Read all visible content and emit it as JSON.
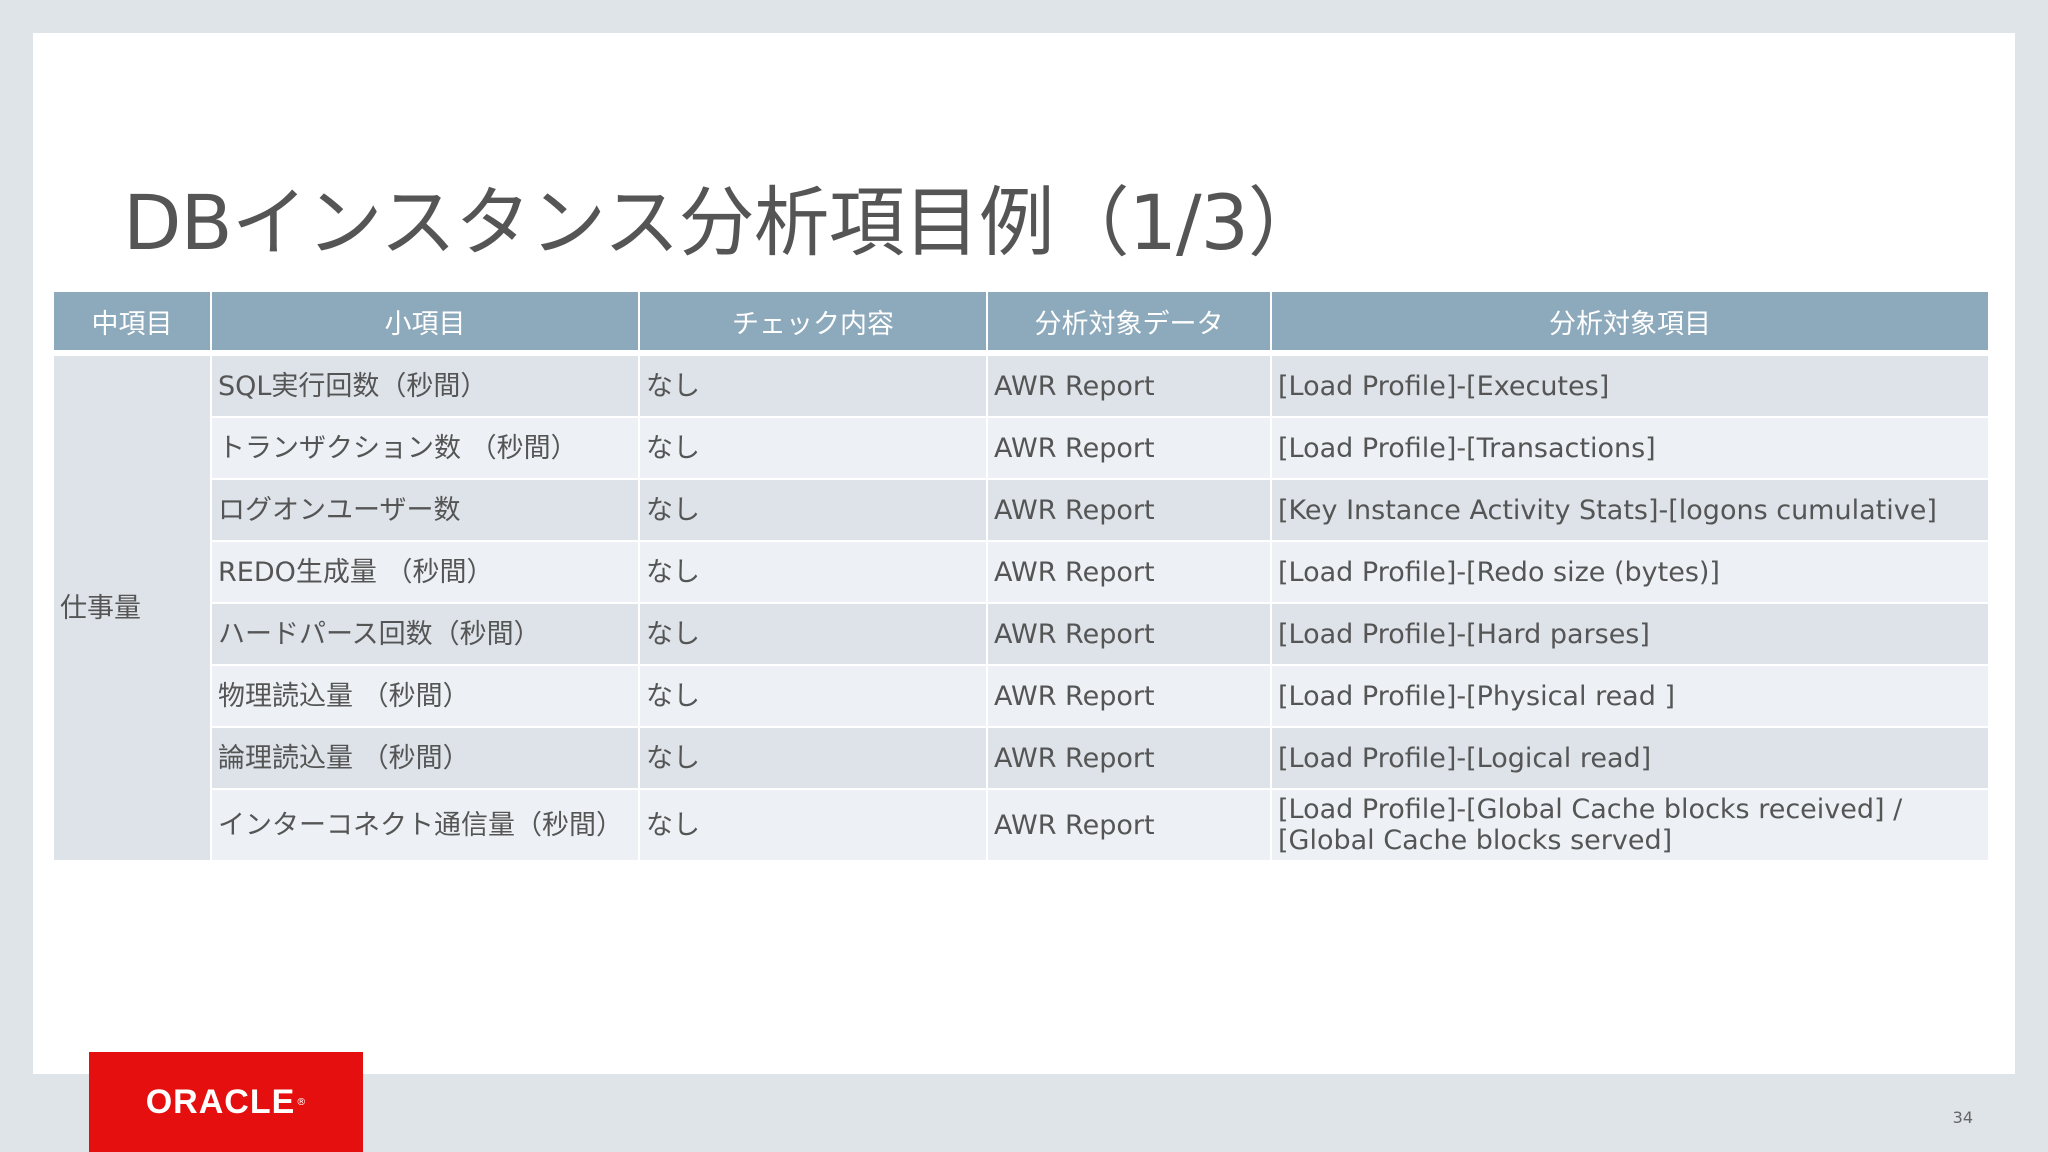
{
  "slide": {
    "title": "DBインスタンス分析項目例（1/3）",
    "page_number": "34"
  },
  "table": {
    "headers": [
      "中項目",
      "小項目",
      "チェック内容",
      "分析対象データ",
      "分析対象項目"
    ],
    "group_label": "仕事量",
    "rows": [
      {
        "sub": "SQL実行回数（秒間）",
        "check": "なし",
        "data": "AWR Report",
        "item": "[Load Profile]-[Executes]"
      },
      {
        "sub": "トランザクション数 （秒間）",
        "check": "なし",
        "data": "AWR Report",
        "item": "[Load Profile]-[Transactions]"
      },
      {
        "sub": "ログオンユーザー数",
        "check": "なし",
        "data": "AWR Report",
        "item": "[Key Instance Activity Stats]-[logons cumulative]"
      },
      {
        "sub": "REDO生成量 （秒間）",
        "check": "なし",
        "data": "AWR Report",
        "item": "[Load Profile]-[Redo size (bytes)]"
      },
      {
        "sub": "ハードパース回数（秒間）",
        "check": "なし",
        "data": "AWR Report",
        "item": "[Load Profile]-[Hard parses]"
      },
      {
        "sub": "物理読込量 （秒間）",
        "check": "なし",
        "data": "AWR Report",
        "item": "[Load Profile]-[Physical read ]"
      },
      {
        "sub": "論理読込量 （秒間）",
        "check": "なし",
        "data": "AWR Report",
        "item": "[Load Profile]-[Logical read]"
      },
      {
        "sub": "インターコネクト通信量（秒間）",
        "check": "なし",
        "data": "AWR Report",
        "item": "[Load Profile]-[Global Cache blocks received] / [Global Cache blocks served]"
      }
    ]
  },
  "logo": {
    "text": "ORACLE",
    "mark": "®",
    "color": "#e60f0f"
  },
  "colors": {
    "header_bg": "#8da9bc",
    "row_dark": "#dde3e9",
    "row_light": "#edf1f5",
    "outer_bg": "#dfe4e9"
  }
}
